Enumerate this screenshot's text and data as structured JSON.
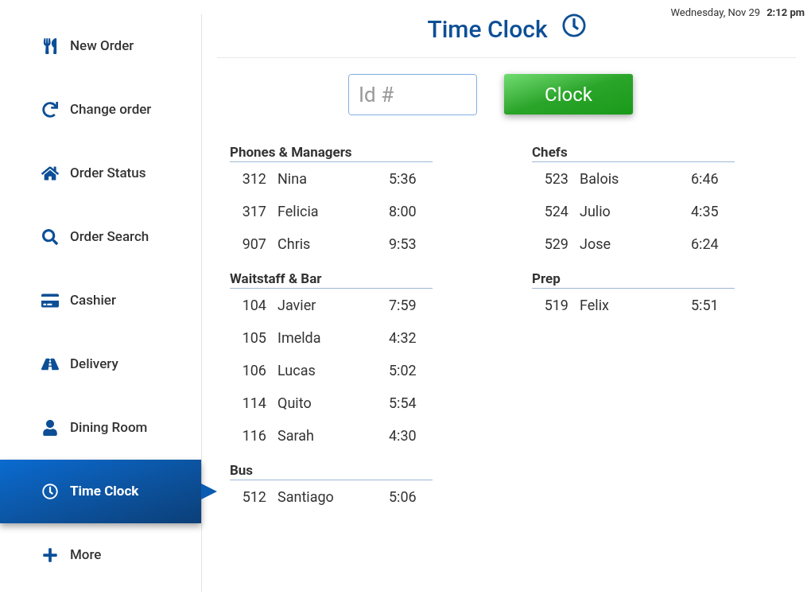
{
  "datetime": {
    "date": "Wednesday, Nov 29",
    "time": "2:12 pm"
  },
  "sidebar": {
    "items": [
      {
        "label": "New Order",
        "selected": false
      },
      {
        "label": "Change order",
        "selected": false
      },
      {
        "label": "Order Status",
        "selected": false
      },
      {
        "label": "Order Search",
        "selected": false
      },
      {
        "label": "Cashier",
        "selected": false
      },
      {
        "label": "Delivery",
        "selected": false
      },
      {
        "label": "Dining Room",
        "selected": false
      },
      {
        "label": "Time Clock",
        "selected": true
      },
      {
        "label": "More",
        "selected": false
      }
    ]
  },
  "title": "Time Clock",
  "id_field": {
    "placeholder": "Id #"
  },
  "clock_button": "Clock",
  "columns": [
    [
      {
        "name": "Phones & Managers",
        "rows": [
          {
            "id": "312",
            "name": "Nina",
            "time": "5:36"
          },
          {
            "id": "317",
            "name": "Felicia",
            "time": "8:00"
          },
          {
            "id": "907",
            "name": "Chris",
            "time": "9:53"
          }
        ]
      },
      {
        "name": "Waitstaff & Bar",
        "rows": [
          {
            "id": "104",
            "name": "Javier",
            "time": "7:59"
          },
          {
            "id": "105",
            "name": "Imelda",
            "time": "4:32"
          },
          {
            "id": "106",
            "name": "Lucas",
            "time": "5:02"
          },
          {
            "id": "114",
            "name": "Quito",
            "time": "5:54"
          },
          {
            "id": "116",
            "name": "Sarah",
            "time": "4:30"
          }
        ]
      },
      {
        "name": "Bus",
        "rows": [
          {
            "id": "512",
            "name": "Santiago",
            "time": "5:06"
          }
        ]
      }
    ],
    [
      {
        "name": "Chefs",
        "rows": [
          {
            "id": "523",
            "name": "Balois",
            "time": "6:46"
          },
          {
            "id": "524",
            "name": "Julio",
            "time": "4:35"
          },
          {
            "id": "529",
            "name": "Jose",
            "time": "6:24"
          }
        ]
      },
      {
        "name": "Prep",
        "rows": [
          {
            "id": "519",
            "name": "Felix",
            "time": "5:51"
          }
        ]
      }
    ]
  ]
}
